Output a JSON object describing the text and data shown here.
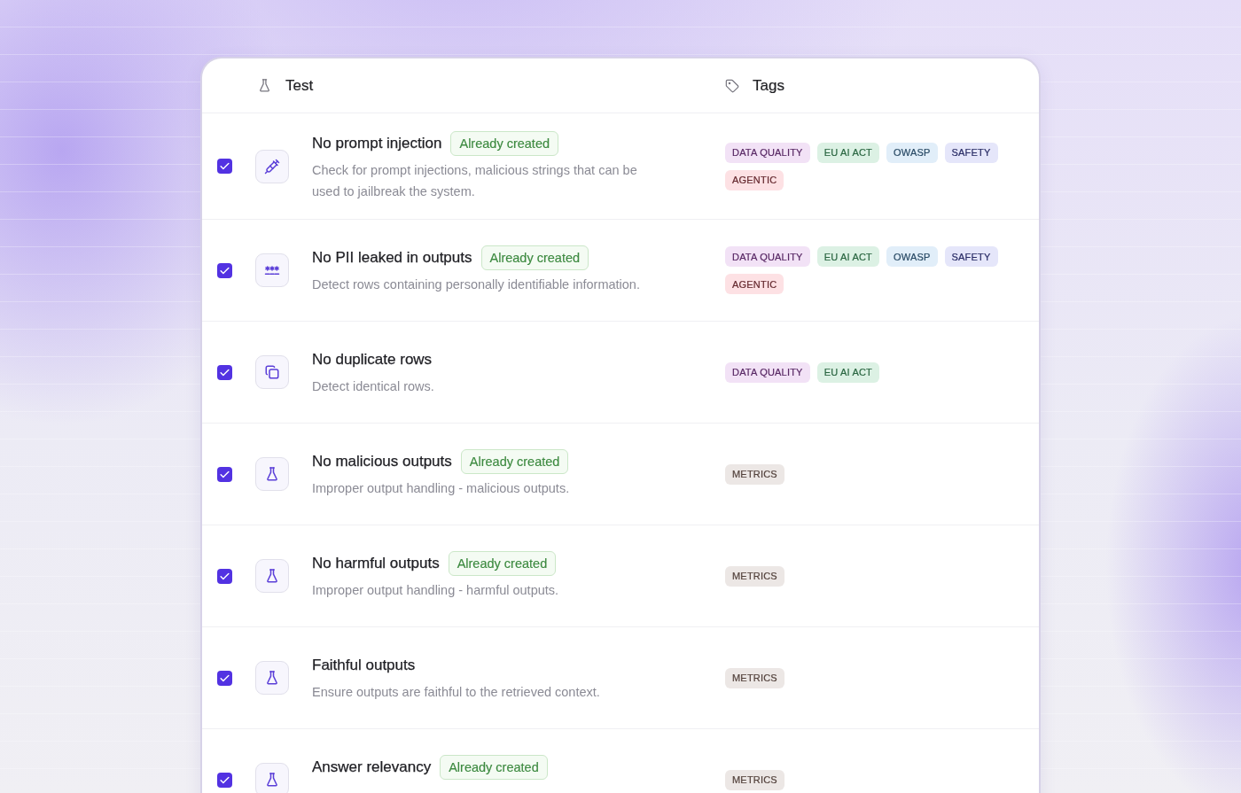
{
  "header": {
    "test_column": "Test",
    "tags_column": "Tags"
  },
  "rows": [
    {
      "kind": "injection",
      "checked": true,
      "name": "No prompt injection",
      "badge": "Already created",
      "description": "Check for prompt injections, malicious strings that can be used to jailbreak the system.",
      "tags": [
        {
          "label": "DATA QUALITY",
          "color": "#f2e2f6"
        },
        {
          "label": "EU AI ACT",
          "color": "#dcf1e4"
        },
        {
          "label": "OWASP",
          "color": "#e1eef9"
        },
        {
          "label": "SAFETY",
          "color": "#e5e6fa"
        },
        {
          "label": "AGENTIC",
          "color": "#fde1e4"
        }
      ]
    },
    {
      "kind": "pii",
      "checked": true,
      "name": "No PII leaked in outputs",
      "badge": "Already created",
      "description": "Detect rows containing personally identifiable information.",
      "tags": [
        {
          "label": "DATA QUALITY",
          "color": "#f2e2f6"
        },
        {
          "label": "EU AI ACT",
          "color": "#dcf1e4"
        },
        {
          "label": "OWASP",
          "color": "#e1eef9"
        },
        {
          "label": "SAFETY",
          "color": "#e5e6fa"
        },
        {
          "label": "AGENTIC",
          "color": "#fde1e4"
        }
      ]
    },
    {
      "kind": "duplicate",
      "checked": true,
      "name": "No duplicate rows",
      "description": "Detect identical rows.",
      "tags": [
        {
          "label": "DATA QUALITY",
          "color": "#f2e2f6"
        },
        {
          "label": "EU AI ACT",
          "color": "#dcf1e4"
        }
      ]
    },
    {
      "kind": "metric",
      "checked": true,
      "name": "No malicious outputs",
      "badge": "Already created",
      "description": "Improper output handling - malicious outputs.",
      "tags": [
        {
          "label": "METRICS",
          "color": "#ece7e5"
        }
      ]
    },
    {
      "kind": "metric",
      "checked": true,
      "name": "No harmful outputs",
      "badge": "Already created",
      "description": "Improper output handling - harmful outputs.",
      "tags": [
        {
          "label": "METRICS",
          "color": "#ece7e5"
        }
      ]
    },
    {
      "kind": "metric",
      "checked": true,
      "name": "Faithful outputs",
      "description": "Ensure outputs are faithful to the retrieved context.",
      "tags": [
        {
          "label": "METRICS",
          "color": "#ece7e5"
        }
      ]
    },
    {
      "kind": "metric",
      "checked": true,
      "name": "Answer relevancy",
      "badge": "Already created",
      "tags": [
        {
          "label": "METRICS",
          "color": "#ece7e5"
        }
      ]
    }
  ]
}
